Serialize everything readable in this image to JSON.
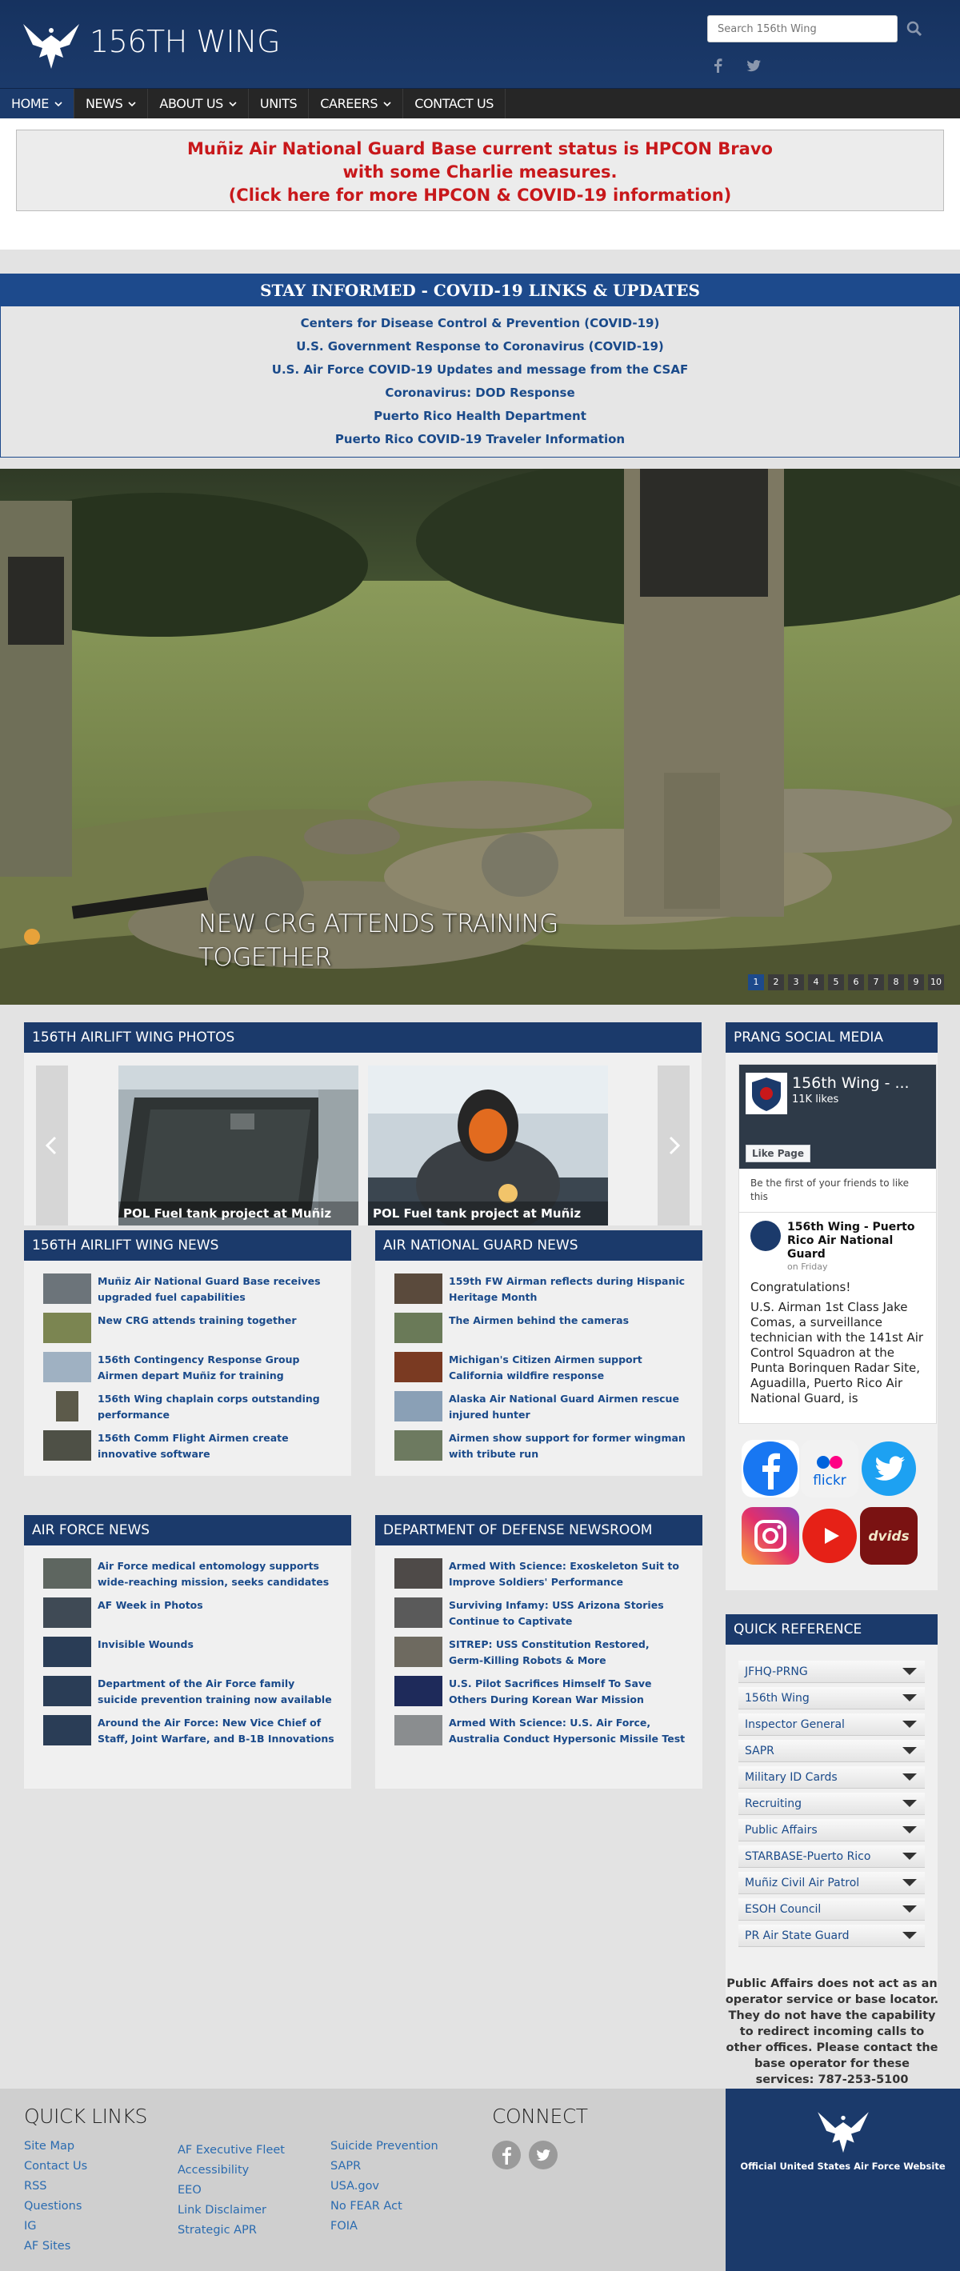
{
  "header": {
    "site_title": "156TH WING",
    "search_placeholder": "Search 156th Wing"
  },
  "nav": {
    "items": [
      {
        "label": "HOME",
        "dropdown": true,
        "active": true
      },
      {
        "label": "NEWS",
        "dropdown": true
      },
      {
        "label": "ABOUT US",
        "dropdown": true
      },
      {
        "label": "UNITS",
        "dropdown": false
      },
      {
        "label": "CAREERS",
        "dropdown": true
      },
      {
        "label": "CONTACT US",
        "dropdown": false
      }
    ]
  },
  "alert": {
    "line1": "Muñiz Air National Guard Base current status is HPCON Bravo",
    "line2": "with some Charlie measures.",
    "line3": "(Click here for more HPCON & COVID-19 information)"
  },
  "covid": {
    "title": "STAY INFORMED - COVID-19 LINKS & UPDATES",
    "links": [
      "Centers for Disease Control & Prevention (COVID-19)",
      "U.S. Government Response to Coronavirus (COVID-19)",
      "U.S. Air Force COVID-19 Updates and message from the CSAF",
      "Coronavirus: DOD Response",
      "Puerto Rico Health Department",
      "Puerto Rico COVID-19 Traveler Information"
    ]
  },
  "hero": {
    "caption_line1": "NEW CRG ATTENDS TRAINING",
    "caption_line2": "TOGETHER",
    "pages": [
      "1",
      "2",
      "3",
      "4",
      "5",
      "6",
      "7",
      "8",
      "9",
      "10"
    ],
    "active_page": "1"
  },
  "photos": {
    "title": "156TH AIRLIFT WING PHOTOS",
    "items": [
      {
        "caption": "POL Fuel tank project at Muñiz"
      },
      {
        "caption": "POL Fuel tank project at Muñiz"
      }
    ]
  },
  "wing_news": {
    "title": "156TH AIRLIFT WING NEWS",
    "items": [
      "Muñiz Air National Guard Base receives upgraded fuel capabilities",
      "New CRG attends training together",
      "156th Contingency Response Group Airmen depart Muñiz for training",
      "156th Wing chaplain corps outstanding performance",
      "156th Comm Flight Airmen create innovative software"
    ]
  },
  "ang_news": {
    "title": "AIR NATIONAL GUARD NEWS",
    "items": [
      "159th FW Airman reflects during Hispanic Heritage Month",
      "The Airmen behind the cameras",
      "Michigan's Citizen Airmen support California wildfire response",
      "Alaska Air National Guard Airmen rescue injured hunter",
      "Airmen show support for former wingman with tribute run"
    ]
  },
  "af_news": {
    "title": "AIR FORCE NEWS",
    "items": [
      "Air Force medical entomology supports wide-reaching mission, seeks candidates",
      "AF Week in Photos",
      "Invisible Wounds",
      "Department of the Air Force family suicide prevention training now available",
      "Around the Air Force: New Vice Chief of Staff, Joint Warfare, and B-1B Innovations"
    ]
  },
  "dod_news": {
    "title": "DEPARTMENT OF DEFENSE NEWSROOM",
    "items": [
      "Armed With Science: Exoskeleton Suit to Improve Soldiers' Performance",
      "Surviving Infamy: USS Arizona Stories Continue to Captivate",
      "SITREP: USS Constitution Restored, Germ-Killing Robots & More",
      "U.S. Pilot Sacrifices Himself To Save Others During Korean War Mission",
      "Armed With Science: U.S. Air Force, Australia Conduct Hypersonic Missile Test"
    ]
  },
  "social": {
    "title": "PRANG SOCIAL MEDIA",
    "fb_page_name": "156th Wing - ...",
    "fb_likes": "11K likes",
    "fb_like_button": "Like Page",
    "fb_friends_text": "Be the first of your friends to like this",
    "post_name": "156th Wing - Puerto Rico Air National Guard",
    "post_time": "on Friday",
    "post_greeting": "Congratulations!",
    "post_body": "U.S. Airman 1st Class Jake Comas, a surveillance technician with the 141st Air Control Squadron at the Punta Borinquen Radar Site, Aguadilla, Puerto Rico Air National Guard, is",
    "flickr_label": "flickr",
    "dvids_label": "dvids",
    "icons": [
      "facebook-icon",
      "flickr-icon",
      "twitter-icon",
      "instagram-icon",
      "youtube-icon",
      "dvids-icon"
    ]
  },
  "quick_reference": {
    "title": "QUICK REFERENCE",
    "items": [
      "JFHQ-PRNG",
      "156th Wing",
      "Inspector General",
      "SAPR",
      "Military ID Cards",
      "Recruiting",
      "Public Affairs",
      "STARBASE-Puerto Rico",
      "Muñiz Civil Air Patrol",
      "ESOH Council",
      "PR Air State Guard"
    ]
  },
  "pa_note": "Public Affairs does not act as an operator service or base locator. They do not have the capability to redirect incoming calls to other offices. Please contact the base operator for these services: 787-253-5100",
  "footer": {
    "quick_links_title": "QUICK LINKS",
    "col1": [
      "Site Map",
      "Contact Us",
      "RSS",
      "Questions",
      "IG",
      "AF Sites"
    ],
    "col2": [
      "AF Executive Fleet",
      "Accessibility",
      "EEO",
      "Link Disclaimer",
      "Strategic APR"
    ],
    "col3": [
      "Suicide Prevention",
      "SAPR",
      "USA.gov",
      "No FEAR Act",
      "FOIA"
    ],
    "connect_title": "CONNECT",
    "af_site_label": "Official United States Air Force Website"
  },
  "colors": {
    "brand_navy": "#1b3a6b",
    "alert_red": "#c8181b",
    "link_blue": "#1a4a8a"
  }
}
